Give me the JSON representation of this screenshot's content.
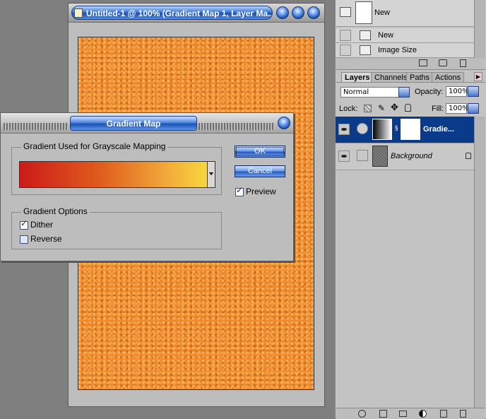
{
  "document_window": {
    "title": "Untitled-1 @ 100% (Gradient Map 1, Layer Ma..."
  },
  "history_panel": {
    "items": [
      {
        "label": "New",
        "icon": "snapshot-thumbnail"
      },
      {
        "label": "New",
        "icon": "history-state-icon"
      },
      {
        "label": "Image Size",
        "icon": "history-state-icon"
      }
    ]
  },
  "layers_panel": {
    "tabs": [
      {
        "label": "Layers",
        "active": true
      },
      {
        "label": "Channels",
        "active": false
      },
      {
        "label": "Paths",
        "active": false
      },
      {
        "label": "Actions",
        "active": false
      }
    ],
    "blend_mode": "Normal",
    "opacity_label": "Opacity:",
    "opacity_value": "100%",
    "lock_label": "Lock:",
    "fill_label": "Fill:",
    "fill_value": "100%",
    "layers": [
      {
        "name": "Gradie...",
        "selected": true,
        "type": "adjustment"
      },
      {
        "name": "Background",
        "selected": false,
        "type": "image",
        "locked": true
      }
    ]
  },
  "dialog": {
    "title": "Gradient Map",
    "group_gradient_label": "Gradient Used for Grayscale Mapping",
    "gradient_colors": [
      "#cc1a1a",
      "#e05a1c",
      "#f2a83a",
      "#f8df3f"
    ],
    "group_options_label": "Gradient Options",
    "dither_label": "Dither",
    "dither_checked": true,
    "reverse_label": "Reverse",
    "reverse_checked": false,
    "ok_label": "OK",
    "cancel_label": "Cancel",
    "preview_label": "Preview",
    "preview_checked": true
  },
  "colors": {
    "canvas_orange": "#f08a2a",
    "selected_layer_blue": "#0a3a8a",
    "title_blue": "#1e51b2"
  }
}
